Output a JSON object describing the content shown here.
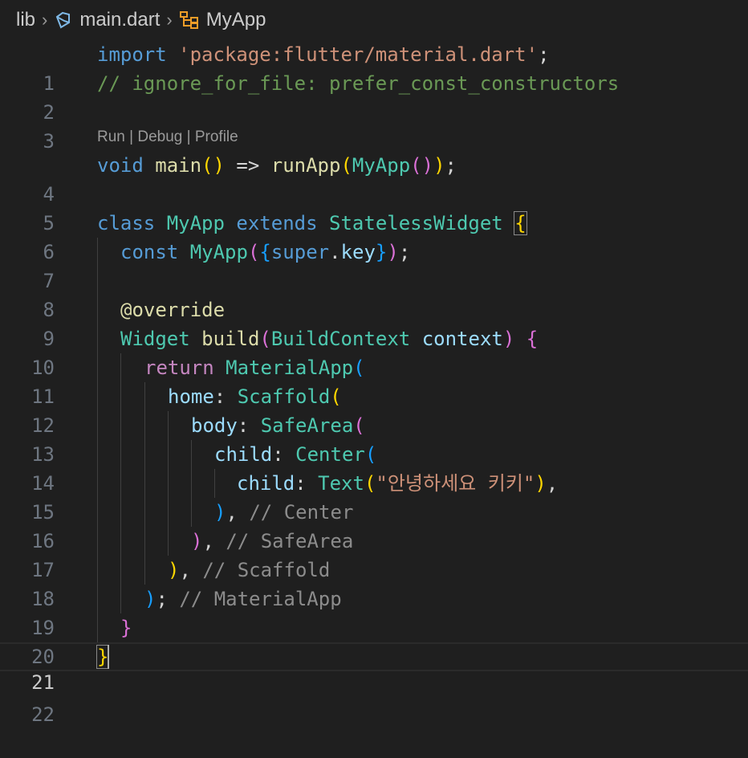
{
  "breadcrumb": {
    "folder": "lib",
    "file": "main.dart",
    "symbol": "MyApp"
  },
  "codelens": {
    "run": "Run",
    "sep1": " | ",
    "debug": "Debug",
    "sep2": " | ",
    "profile": "Profile"
  },
  "current_line": 21,
  "line_numbers": [
    "1",
    "2",
    "3",
    "4",
    "5",
    "6",
    "7",
    "8",
    "9",
    "10",
    "11",
    "12",
    "13",
    "14",
    "15",
    "16",
    "17",
    "18",
    "19",
    "20",
    "21",
    "22"
  ],
  "code": {
    "l1": {
      "kw": "import",
      "sp": " ",
      "str": "'package:flutter/material.dart'",
      "end": ";"
    },
    "l2": {
      "cmt": "// ignore_for_file: prefer_const_constructors"
    },
    "l4": {
      "t1": "void",
      "t2": " ",
      "t3": "main",
      "t4": "()",
      "t5": " => ",
      "t6": "runApp",
      "t7": "(",
      "t8": "MyApp",
      "t9": "()",
      "t10": ")",
      "t11": ";"
    },
    "l6": {
      "t1": "class",
      "t2": " ",
      "t3": "MyApp",
      "t4": " ",
      "t5": "extends",
      "t6": " ",
      "t7": "StatelessWidget",
      "t8": " ",
      "t9": "{"
    },
    "l7": {
      "t1": "const",
      "t2": " ",
      "t3": "MyApp",
      "t4": "(",
      "t5": "{",
      "t6": "super",
      "t7": ".",
      "t8": "key",
      "t9": "}",
      "t10": ")",
      "t11": ";"
    },
    "l9": {
      "t1": "@override"
    },
    "l10": {
      "t1": "Widget",
      "t2": " ",
      "t3": "build",
      "t4": "(",
      "t5": "BuildContext",
      "t6": " ",
      "t7": "context",
      "t8": ")",
      "t9": " ",
      "t10": "{"
    },
    "l11": {
      "t1": "return",
      "t2": " ",
      "t3": "MaterialApp",
      "t4": "("
    },
    "l12": {
      "t1": "home",
      "t2": ": ",
      "t3": "Scaffold",
      "t4": "("
    },
    "l13": {
      "t1": "body",
      "t2": ": ",
      "t3": "SafeArea",
      "t4": "("
    },
    "l14": {
      "t1": "child",
      "t2": ": ",
      "t3": "Center",
      "t4": "("
    },
    "l15": {
      "t1": "child",
      "t2": ": ",
      "t3": "Text",
      "t4": "(",
      "t5": "\"안녕하세요 키키\"",
      "t6": ")",
      "t7": ","
    },
    "l16": {
      "t1": ")",
      "t2": ", ",
      "t3": "// Center"
    },
    "l17": {
      "t1": ")",
      "t2": ", ",
      "t3": "// SafeArea"
    },
    "l18": {
      "t1": ")",
      "t2": ", ",
      "t3": "// Scaffold"
    },
    "l19": {
      "t1": ")",
      "t2": "; ",
      "t3": "// MaterialApp"
    },
    "l20": {
      "t1": "}"
    },
    "l21": {
      "t1": "}"
    }
  },
  "colors": {
    "background": "#1f1f1f",
    "keyword": "#569cd6",
    "control": "#c586c0",
    "string": "#ce9178",
    "comment": "#6a9955",
    "function": "#dcdcaa",
    "type": "#4ec9b0",
    "variable": "#9cdcfe",
    "bracket1": "#ffd700",
    "bracket2": "#da70d6",
    "bracket3": "#179fff"
  }
}
